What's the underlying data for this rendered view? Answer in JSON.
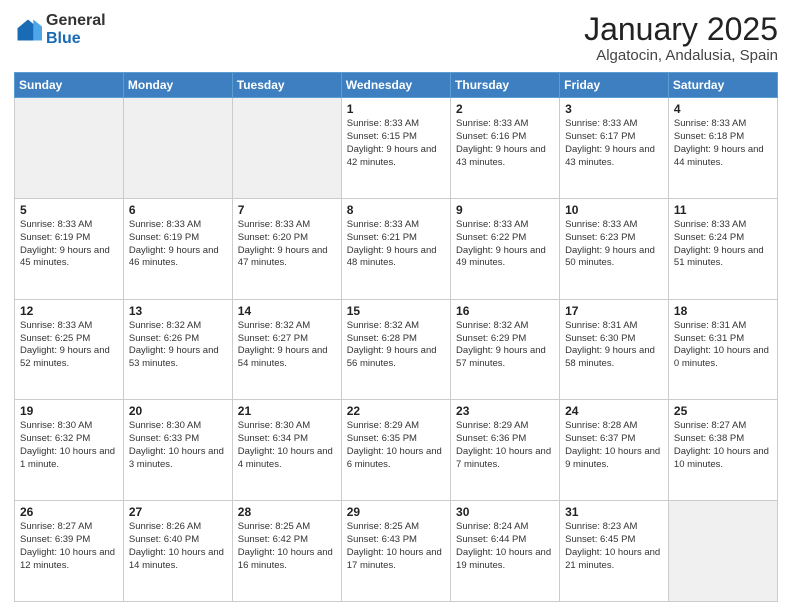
{
  "logo": {
    "general": "General",
    "blue": "Blue"
  },
  "title": {
    "month": "January 2025",
    "location": "Algatocin, Andalusia, Spain"
  },
  "days_header": [
    "Sunday",
    "Monday",
    "Tuesday",
    "Wednesday",
    "Thursday",
    "Friday",
    "Saturday"
  ],
  "weeks": [
    [
      {
        "num": "",
        "detail": ""
      },
      {
        "num": "",
        "detail": ""
      },
      {
        "num": "",
        "detail": ""
      },
      {
        "num": "1",
        "detail": "Sunrise: 8:33 AM\nSunset: 6:15 PM\nDaylight: 9 hours\nand 42 minutes."
      },
      {
        "num": "2",
        "detail": "Sunrise: 8:33 AM\nSunset: 6:16 PM\nDaylight: 9 hours\nand 43 minutes."
      },
      {
        "num": "3",
        "detail": "Sunrise: 8:33 AM\nSunset: 6:17 PM\nDaylight: 9 hours\nand 43 minutes."
      },
      {
        "num": "4",
        "detail": "Sunrise: 8:33 AM\nSunset: 6:18 PM\nDaylight: 9 hours\nand 44 minutes."
      }
    ],
    [
      {
        "num": "5",
        "detail": "Sunrise: 8:33 AM\nSunset: 6:19 PM\nDaylight: 9 hours\nand 45 minutes."
      },
      {
        "num": "6",
        "detail": "Sunrise: 8:33 AM\nSunset: 6:19 PM\nDaylight: 9 hours\nand 46 minutes."
      },
      {
        "num": "7",
        "detail": "Sunrise: 8:33 AM\nSunset: 6:20 PM\nDaylight: 9 hours\nand 47 minutes."
      },
      {
        "num": "8",
        "detail": "Sunrise: 8:33 AM\nSunset: 6:21 PM\nDaylight: 9 hours\nand 48 minutes."
      },
      {
        "num": "9",
        "detail": "Sunrise: 8:33 AM\nSunset: 6:22 PM\nDaylight: 9 hours\nand 49 minutes."
      },
      {
        "num": "10",
        "detail": "Sunrise: 8:33 AM\nSunset: 6:23 PM\nDaylight: 9 hours\nand 50 minutes."
      },
      {
        "num": "11",
        "detail": "Sunrise: 8:33 AM\nSunset: 6:24 PM\nDaylight: 9 hours\nand 51 minutes."
      }
    ],
    [
      {
        "num": "12",
        "detail": "Sunrise: 8:33 AM\nSunset: 6:25 PM\nDaylight: 9 hours\nand 52 minutes."
      },
      {
        "num": "13",
        "detail": "Sunrise: 8:32 AM\nSunset: 6:26 PM\nDaylight: 9 hours\nand 53 minutes."
      },
      {
        "num": "14",
        "detail": "Sunrise: 8:32 AM\nSunset: 6:27 PM\nDaylight: 9 hours\nand 54 minutes."
      },
      {
        "num": "15",
        "detail": "Sunrise: 8:32 AM\nSunset: 6:28 PM\nDaylight: 9 hours\nand 56 minutes."
      },
      {
        "num": "16",
        "detail": "Sunrise: 8:32 AM\nSunset: 6:29 PM\nDaylight: 9 hours\nand 57 minutes."
      },
      {
        "num": "17",
        "detail": "Sunrise: 8:31 AM\nSunset: 6:30 PM\nDaylight: 9 hours\nand 58 minutes."
      },
      {
        "num": "18",
        "detail": "Sunrise: 8:31 AM\nSunset: 6:31 PM\nDaylight: 10 hours\nand 0 minutes."
      }
    ],
    [
      {
        "num": "19",
        "detail": "Sunrise: 8:30 AM\nSunset: 6:32 PM\nDaylight: 10 hours\nand 1 minute."
      },
      {
        "num": "20",
        "detail": "Sunrise: 8:30 AM\nSunset: 6:33 PM\nDaylight: 10 hours\nand 3 minutes."
      },
      {
        "num": "21",
        "detail": "Sunrise: 8:30 AM\nSunset: 6:34 PM\nDaylight: 10 hours\nand 4 minutes."
      },
      {
        "num": "22",
        "detail": "Sunrise: 8:29 AM\nSunset: 6:35 PM\nDaylight: 10 hours\nand 6 minutes."
      },
      {
        "num": "23",
        "detail": "Sunrise: 8:29 AM\nSunset: 6:36 PM\nDaylight: 10 hours\nand 7 minutes."
      },
      {
        "num": "24",
        "detail": "Sunrise: 8:28 AM\nSunset: 6:37 PM\nDaylight: 10 hours\nand 9 minutes."
      },
      {
        "num": "25",
        "detail": "Sunrise: 8:27 AM\nSunset: 6:38 PM\nDaylight: 10 hours\nand 10 minutes."
      }
    ],
    [
      {
        "num": "26",
        "detail": "Sunrise: 8:27 AM\nSunset: 6:39 PM\nDaylight: 10 hours\nand 12 minutes."
      },
      {
        "num": "27",
        "detail": "Sunrise: 8:26 AM\nSunset: 6:40 PM\nDaylight: 10 hours\nand 14 minutes."
      },
      {
        "num": "28",
        "detail": "Sunrise: 8:25 AM\nSunset: 6:42 PM\nDaylight: 10 hours\nand 16 minutes."
      },
      {
        "num": "29",
        "detail": "Sunrise: 8:25 AM\nSunset: 6:43 PM\nDaylight: 10 hours\nand 17 minutes."
      },
      {
        "num": "30",
        "detail": "Sunrise: 8:24 AM\nSunset: 6:44 PM\nDaylight: 10 hours\nand 19 minutes."
      },
      {
        "num": "31",
        "detail": "Sunrise: 8:23 AM\nSunset: 6:45 PM\nDaylight: 10 hours\nand 21 minutes."
      },
      {
        "num": "",
        "detail": ""
      }
    ]
  ]
}
